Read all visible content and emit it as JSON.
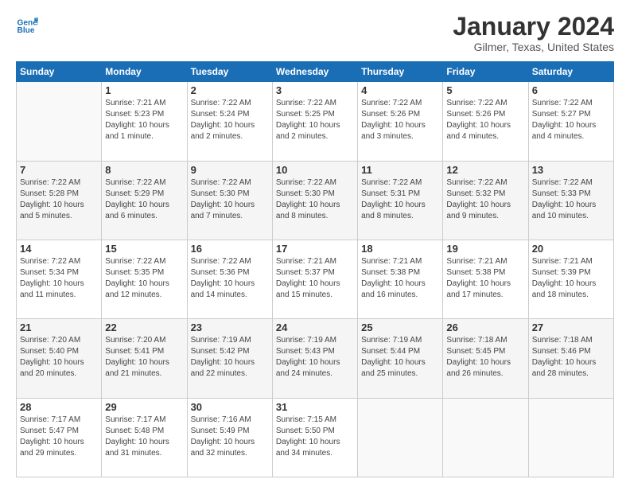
{
  "logo": {
    "line1": "General",
    "line2": "Blue"
  },
  "header": {
    "month": "January 2024",
    "location": "Gilmer, Texas, United States"
  },
  "weekdays": [
    "Sunday",
    "Monday",
    "Tuesday",
    "Wednesday",
    "Thursday",
    "Friday",
    "Saturday"
  ],
  "weeks": [
    [
      {
        "day": "",
        "sunrise": "",
        "sunset": "",
        "daylight": ""
      },
      {
        "day": "1",
        "sunrise": "Sunrise: 7:21 AM",
        "sunset": "Sunset: 5:23 PM",
        "daylight": "Daylight: 10 hours and 1 minute."
      },
      {
        "day": "2",
        "sunrise": "Sunrise: 7:22 AM",
        "sunset": "Sunset: 5:24 PM",
        "daylight": "Daylight: 10 hours and 2 minutes."
      },
      {
        "day": "3",
        "sunrise": "Sunrise: 7:22 AM",
        "sunset": "Sunset: 5:25 PM",
        "daylight": "Daylight: 10 hours and 2 minutes."
      },
      {
        "day": "4",
        "sunrise": "Sunrise: 7:22 AM",
        "sunset": "Sunset: 5:26 PM",
        "daylight": "Daylight: 10 hours and 3 minutes."
      },
      {
        "day": "5",
        "sunrise": "Sunrise: 7:22 AM",
        "sunset": "Sunset: 5:26 PM",
        "daylight": "Daylight: 10 hours and 4 minutes."
      },
      {
        "day": "6",
        "sunrise": "Sunrise: 7:22 AM",
        "sunset": "Sunset: 5:27 PM",
        "daylight": "Daylight: 10 hours and 4 minutes."
      }
    ],
    [
      {
        "day": "7",
        "sunrise": "Sunrise: 7:22 AM",
        "sunset": "Sunset: 5:28 PM",
        "daylight": "Daylight: 10 hours and 5 minutes."
      },
      {
        "day": "8",
        "sunrise": "Sunrise: 7:22 AM",
        "sunset": "Sunset: 5:29 PM",
        "daylight": "Daylight: 10 hours and 6 minutes."
      },
      {
        "day": "9",
        "sunrise": "Sunrise: 7:22 AM",
        "sunset": "Sunset: 5:30 PM",
        "daylight": "Daylight: 10 hours and 7 minutes."
      },
      {
        "day": "10",
        "sunrise": "Sunrise: 7:22 AM",
        "sunset": "Sunset: 5:30 PM",
        "daylight": "Daylight: 10 hours and 8 minutes."
      },
      {
        "day": "11",
        "sunrise": "Sunrise: 7:22 AM",
        "sunset": "Sunset: 5:31 PM",
        "daylight": "Daylight: 10 hours and 8 minutes."
      },
      {
        "day": "12",
        "sunrise": "Sunrise: 7:22 AM",
        "sunset": "Sunset: 5:32 PM",
        "daylight": "Daylight: 10 hours and 9 minutes."
      },
      {
        "day": "13",
        "sunrise": "Sunrise: 7:22 AM",
        "sunset": "Sunset: 5:33 PM",
        "daylight": "Daylight: 10 hours and 10 minutes."
      }
    ],
    [
      {
        "day": "14",
        "sunrise": "Sunrise: 7:22 AM",
        "sunset": "Sunset: 5:34 PM",
        "daylight": "Daylight: 10 hours and 11 minutes."
      },
      {
        "day": "15",
        "sunrise": "Sunrise: 7:22 AM",
        "sunset": "Sunset: 5:35 PM",
        "daylight": "Daylight: 10 hours and 12 minutes."
      },
      {
        "day": "16",
        "sunrise": "Sunrise: 7:22 AM",
        "sunset": "Sunset: 5:36 PM",
        "daylight": "Daylight: 10 hours and 14 minutes."
      },
      {
        "day": "17",
        "sunrise": "Sunrise: 7:21 AM",
        "sunset": "Sunset: 5:37 PM",
        "daylight": "Daylight: 10 hours and 15 minutes."
      },
      {
        "day": "18",
        "sunrise": "Sunrise: 7:21 AM",
        "sunset": "Sunset: 5:38 PM",
        "daylight": "Daylight: 10 hours and 16 minutes."
      },
      {
        "day": "19",
        "sunrise": "Sunrise: 7:21 AM",
        "sunset": "Sunset: 5:38 PM",
        "daylight": "Daylight: 10 hours and 17 minutes."
      },
      {
        "day": "20",
        "sunrise": "Sunrise: 7:21 AM",
        "sunset": "Sunset: 5:39 PM",
        "daylight": "Daylight: 10 hours and 18 minutes."
      }
    ],
    [
      {
        "day": "21",
        "sunrise": "Sunrise: 7:20 AM",
        "sunset": "Sunset: 5:40 PM",
        "daylight": "Daylight: 10 hours and 20 minutes."
      },
      {
        "day": "22",
        "sunrise": "Sunrise: 7:20 AM",
        "sunset": "Sunset: 5:41 PM",
        "daylight": "Daylight: 10 hours and 21 minutes."
      },
      {
        "day": "23",
        "sunrise": "Sunrise: 7:19 AM",
        "sunset": "Sunset: 5:42 PM",
        "daylight": "Daylight: 10 hours and 22 minutes."
      },
      {
        "day": "24",
        "sunrise": "Sunrise: 7:19 AM",
        "sunset": "Sunset: 5:43 PM",
        "daylight": "Daylight: 10 hours and 24 minutes."
      },
      {
        "day": "25",
        "sunrise": "Sunrise: 7:19 AM",
        "sunset": "Sunset: 5:44 PM",
        "daylight": "Daylight: 10 hours and 25 minutes."
      },
      {
        "day": "26",
        "sunrise": "Sunrise: 7:18 AM",
        "sunset": "Sunset: 5:45 PM",
        "daylight": "Daylight: 10 hours and 26 minutes."
      },
      {
        "day": "27",
        "sunrise": "Sunrise: 7:18 AM",
        "sunset": "Sunset: 5:46 PM",
        "daylight": "Daylight: 10 hours and 28 minutes."
      }
    ],
    [
      {
        "day": "28",
        "sunrise": "Sunrise: 7:17 AM",
        "sunset": "Sunset: 5:47 PM",
        "daylight": "Daylight: 10 hours and 29 minutes."
      },
      {
        "day": "29",
        "sunrise": "Sunrise: 7:17 AM",
        "sunset": "Sunset: 5:48 PM",
        "daylight": "Daylight: 10 hours and 31 minutes."
      },
      {
        "day": "30",
        "sunrise": "Sunrise: 7:16 AM",
        "sunset": "Sunset: 5:49 PM",
        "daylight": "Daylight: 10 hours and 32 minutes."
      },
      {
        "day": "31",
        "sunrise": "Sunrise: 7:15 AM",
        "sunset": "Sunset: 5:50 PM",
        "daylight": "Daylight: 10 hours and 34 minutes."
      },
      {
        "day": "",
        "sunrise": "",
        "sunset": "",
        "daylight": ""
      },
      {
        "day": "",
        "sunrise": "",
        "sunset": "",
        "daylight": ""
      },
      {
        "day": "",
        "sunrise": "",
        "sunset": "",
        "daylight": ""
      }
    ]
  ]
}
